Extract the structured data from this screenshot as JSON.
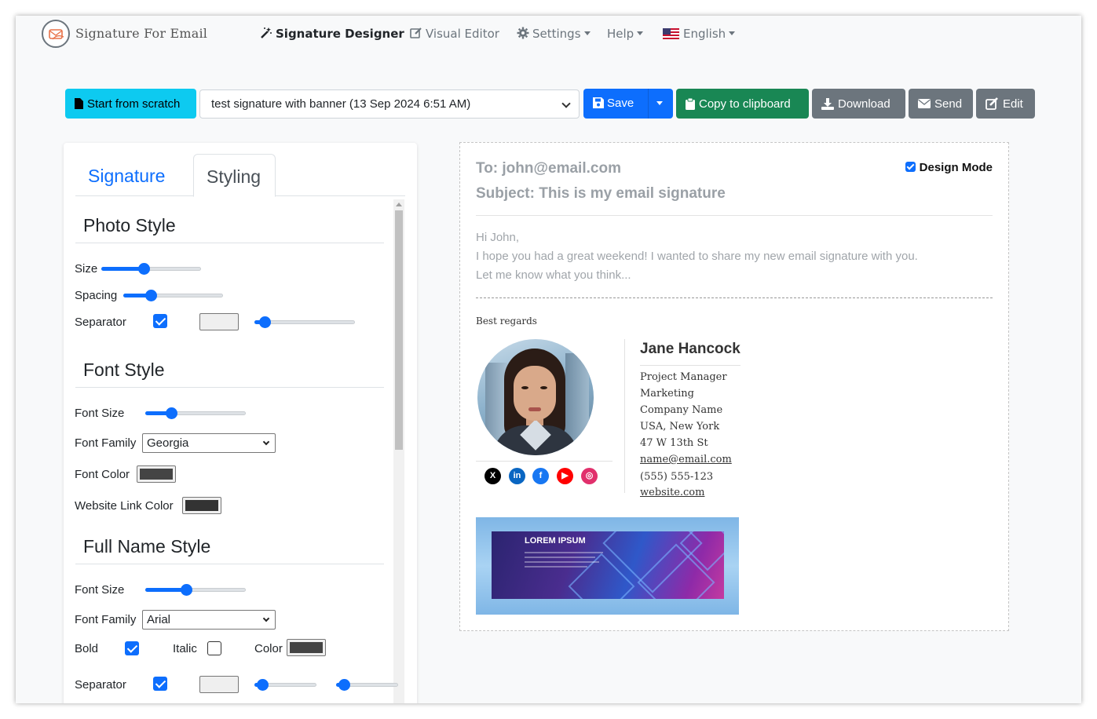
{
  "brand": {
    "name": "Signature For Email"
  },
  "nav": {
    "signature_designer": "Signature Designer",
    "visual_editor": "Visual Editor",
    "settings": "Settings",
    "help": "Help",
    "language": "English"
  },
  "toolbar": {
    "start_from_scratch": "Start from scratch",
    "selected_signature": "test signature with banner (13 Sep 2024 6:51 AM)",
    "save": "Save",
    "copy": "Copy to clipboard",
    "download": "Download",
    "send": "Send",
    "edit": "Edit"
  },
  "tabs": {
    "signature": "Signature",
    "styling": "Styling"
  },
  "photo_style": {
    "title": "Photo Style",
    "size_label": "Size",
    "size_value": 0.42,
    "spacing_label": "Spacing",
    "spacing_value": 0.25,
    "separator_label": "Separator",
    "separator_checked": true,
    "separator_color": "#efefef",
    "separator_width_value": 0.05
  },
  "font_style": {
    "title": "Font Style",
    "font_size_label": "Font Size",
    "font_size_value": 0.23,
    "font_family_label": "Font Family",
    "font_family": "Georgia",
    "font_color_label": "Font Color",
    "font_color": "#444444",
    "link_color_label": "Website Link Color",
    "link_color": "#333333"
  },
  "full_name_style": {
    "title": "Full Name Style",
    "font_size_label": "Font Size",
    "font_size_value": 0.4,
    "font_family_label": "Font Family",
    "font_family": "Arial",
    "bold_label": "Bold",
    "bold_checked": true,
    "italic_label": "Italic",
    "italic_checked": false,
    "color_label": "Color",
    "color": "#444444",
    "separator_label": "Separator",
    "separator_checked": true,
    "separator_color": "#efefef",
    "separator_value_1": 0.05,
    "separator_value_2": 0.05
  },
  "preview": {
    "to": "To: john@email.com",
    "subject": "Subject: This is my email signature",
    "design_mode": "Design Mode",
    "design_mode_checked": true,
    "body_lines": [
      "Hi John,",
      "I hope you had a great weekend! I wanted to share my new email signature with you.",
      "Let me know what you think..."
    ],
    "regards": "Best regards"
  },
  "signature": {
    "name": "Jane Hancock",
    "title": "Project Manager",
    "department": "Marketing",
    "company": "Company Name",
    "location": "USA, New York",
    "street": "47 W 13th St",
    "email": "name@email.com",
    "phone": "(555) 555-123",
    "website": "website.com",
    "social": [
      {
        "icon": "x-icon",
        "glyph": "X",
        "color": "#000000"
      },
      {
        "icon": "linkedin-icon",
        "glyph": "in",
        "color": "#0a66c2"
      },
      {
        "icon": "facebook-icon",
        "glyph": "f",
        "color": "#1877f2"
      },
      {
        "icon": "youtube-icon",
        "glyph": "▶",
        "color": "#ff0000"
      },
      {
        "icon": "instagram-icon",
        "glyph": "◎",
        "color": "#e1306c"
      }
    ]
  },
  "banner": {
    "title": "LOREM IPSUM"
  },
  "colors": {
    "primary": "#0d6efd",
    "info": "#0dcaf0",
    "success": "#198754",
    "secondary": "#6c757d"
  }
}
